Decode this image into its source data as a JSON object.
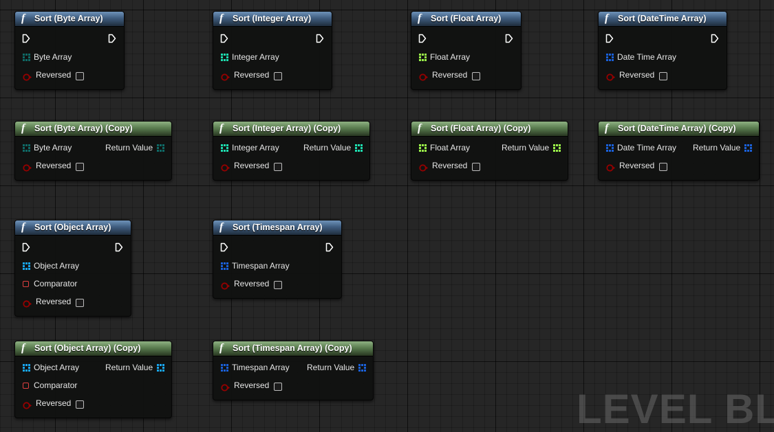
{
  "watermark": "LEVEL BLUI",
  "labels": {
    "reversed": "Reversed",
    "comparator": "Comparator",
    "return_value": "Return Value"
  },
  "colors": {
    "byte_pin": "#0f6a66",
    "integer_pin": "#1edfb0",
    "float_pin": "#9cf84a",
    "datetime_pin": "#1a60d8",
    "object_pin": "#19a6f0",
    "timespan_pin": "#1a60d8",
    "bool_pin": "#960000",
    "impure_header": "#4a6e95",
    "pure_header": "#6a8f5e"
  },
  "nodes": {
    "sort_byte": {
      "title": "Sort (Byte Array)",
      "array_label": "Byte Array"
    },
    "sort_integer": {
      "title": "Sort (Integer Array)",
      "array_label": "Integer Array"
    },
    "sort_float": {
      "title": "Sort (Float Array)",
      "array_label": "Float Array"
    },
    "sort_datetime": {
      "title": "Sort (DateTime Array)",
      "array_label": "Date Time Array"
    },
    "sort_byte_copy": {
      "title": "Sort (Byte Array) (Copy)",
      "array_label": "Byte Array"
    },
    "sort_integer_copy": {
      "title": "Sort (Integer Array) (Copy)",
      "array_label": "Integer Array"
    },
    "sort_float_copy": {
      "title": "Sort (Float Array) (Copy)",
      "array_label": "Float Array"
    },
    "sort_datetime_copy": {
      "title": "Sort (DateTime Array) (Copy)",
      "array_label": "Date Time Array"
    },
    "sort_object": {
      "title": "Sort (Object Array)",
      "array_label": "Object Array"
    },
    "sort_timespan": {
      "title": "Sort (Timespan Array)",
      "array_label": "Timespan Array"
    },
    "sort_object_copy": {
      "title": "Sort (Object Array) (Copy)",
      "array_label": "Object Array"
    },
    "sort_timespan_copy": {
      "title": "Sort (Timespan Array) (Copy)",
      "array_label": "Timespan Array"
    }
  }
}
